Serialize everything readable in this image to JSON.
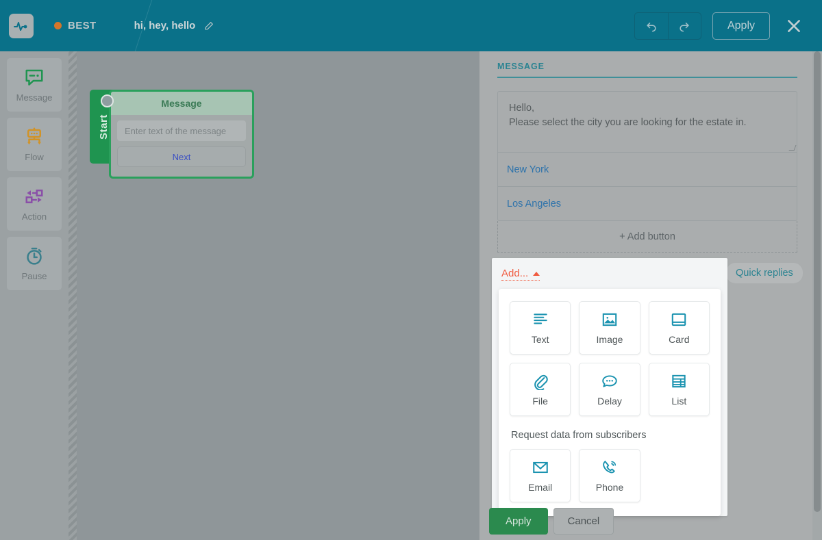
{
  "header": {
    "logo_icon": "pulse-logo-icon",
    "brand": "BEST",
    "status_dot_color": "#d4762a",
    "flow_title": "hi, hey, hello",
    "edit_icon": "pencil-icon",
    "undo_icon": "undo-arrow-icon",
    "redo_icon": "redo-arrow-icon",
    "apply_label": "Apply",
    "close_icon": "close-x-icon",
    "background_color": "#0a7189"
  },
  "sidebar": {
    "items": [
      {
        "label": "Message",
        "icon": "speech-bubble-icon",
        "color": "#1f9450"
      },
      {
        "label": "Flow",
        "icon": "flow-branch-icon",
        "color": "#d19327"
      },
      {
        "label": "Action",
        "icon": "action-arrows-icon",
        "color": "#8a4fa8"
      },
      {
        "label": "Pause",
        "icon": "stopwatch-icon",
        "color": "#3a7f8c"
      }
    ]
  },
  "canvas": {
    "node": {
      "start_label": "Start",
      "title": "Message",
      "input_placeholder": "Enter text of the message",
      "next_label": "Next",
      "connector_icon": "node-connector-dot",
      "border_color": "#2aa05c"
    }
  },
  "panel": {
    "section_title": "MESSAGE",
    "message_text_line1": "Hello,",
    "message_text_line2": "Please select the city you are looking for the estate in.",
    "buttons": [
      {
        "label": "New York"
      },
      {
        "label": "Los Angeles"
      }
    ],
    "add_button_label": "+ Add button",
    "add_dropdown": {
      "trigger_label": "Add...",
      "trigger_icon": "caret-up-icon",
      "trigger_color": "#f05b40",
      "tiles": [
        {
          "label": "Text",
          "icon": "text-lines-icon"
        },
        {
          "label": "Image",
          "icon": "image-picture-icon"
        },
        {
          "label": "Card",
          "icon": "card-icon"
        },
        {
          "label": "File",
          "icon": "paperclip-icon"
        },
        {
          "label": "Delay",
          "icon": "delay-bubble-icon"
        },
        {
          "label": "List",
          "icon": "list-table-icon"
        }
      ],
      "request_section_label": "Request data from subscribers",
      "request_tiles": [
        {
          "label": "Email",
          "icon": "envelope-icon"
        },
        {
          "label": "Phone",
          "icon": "phone-ring-icon"
        }
      ],
      "icon_color": "#1b93b0"
    },
    "quick_replies_label": "Quick replies",
    "footer": {
      "apply_label": "Apply",
      "cancel_label": "Cancel",
      "apply_color": "#2b8a4e"
    }
  }
}
